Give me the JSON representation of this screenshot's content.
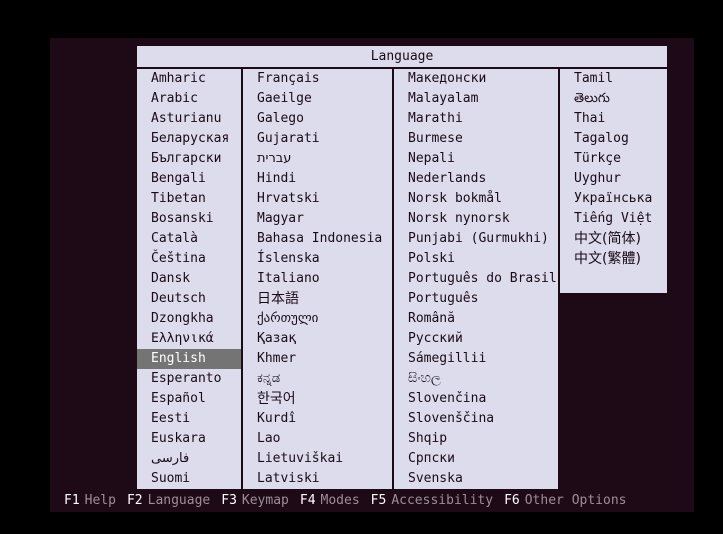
{
  "screen": {
    "background_color": "#000000",
    "console_background_color": "#1e0a17"
  },
  "dialog": {
    "title": "Language",
    "title_bar_color": "#dcdcec",
    "panel_color": "#dcdcec",
    "text_color": "#1e0a17",
    "selection_color": "#747474",
    "selection_text_color": "#ffffff",
    "selected_item": "English",
    "columns": [
      {
        "items": [
          "Amharic",
          "Arabic",
          "Asturianu",
          "Беларуская",
          "Български",
          "Bengali",
          "Tibetan",
          "Bosanski",
          "Català",
          "Čeština",
          "Dansk",
          "Deutsch",
          "Dzongkha",
          "Ελληνικά",
          "English",
          "Esperanto",
          "Español",
          "Eesti",
          "Euskara",
          "فارسی",
          "Suomi"
        ]
      },
      {
        "items": [
          "Français",
          "Gaeilge",
          "Galego",
          "Gujarati",
          "עברית",
          "Hindi",
          "Hrvatski",
          "Magyar",
          "Bahasa Indonesia",
          "Íslenska",
          "Italiano",
          "日本語",
          "ქართული",
          "Қазақ",
          "Khmer",
          "ಕನ್ನಡ",
          "한국어",
          "Kurdî",
          "Lao",
          "Lietuviškai",
          "Latviski"
        ]
      },
      {
        "items": [
          "Македонски",
          "Malayalam",
          "Marathi",
          "Burmese",
          "Nepali",
          "Nederlands",
          "Norsk bokmål",
          "Norsk nynorsk",
          "Punjabi (Gurmukhi)",
          "Polski",
          "Português do Brasil",
          "Português",
          "Română",
          "Русский",
          "Sámegillii",
          "සිංහල",
          "Slovenčina",
          "Slovenščina",
          "Shqip",
          "Српски",
          "Svenska"
        ]
      },
      {
        "items": [
          "Tamil",
          "తెలుగు",
          "Thai",
          "Tagalog",
          "Türkçe",
          "Uyghur",
          "Українська",
          "Tiếng Việt",
          "中文(简体)",
          "中文(繁體)"
        ]
      }
    ]
  },
  "function_bar": {
    "key_color": "#ffffff",
    "label_color": "#9a8f96",
    "keys": [
      {
        "key": "F1",
        "label": "Help"
      },
      {
        "key": "F2",
        "label": "Language"
      },
      {
        "key": "F3",
        "label": "Keymap"
      },
      {
        "key": "F4",
        "label": "Modes"
      },
      {
        "key": "F5",
        "label": "Accessibility"
      },
      {
        "key": "F6",
        "label": "Other Options"
      }
    ]
  }
}
